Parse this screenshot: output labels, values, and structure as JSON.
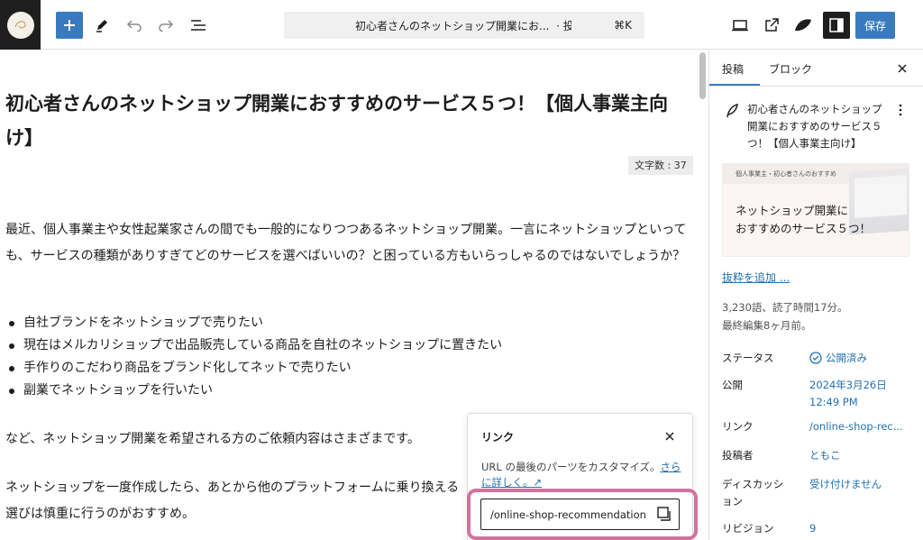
{
  "toolbar": {
    "doc_title": "初心者さんのネットショップ開業にお...",
    "doc_type": "· 投稿",
    "shortcut": "⌘K",
    "save_label": "保存"
  },
  "post": {
    "title": "初心者さんのネットショップ開業におすすめのサービス５つ！【個人事業主向け】",
    "word_count": "文字数 : 37",
    "paragraph1": "最近、個人事業主や女性起業家さんの間でも一般的になりつつあるネットショップ開業。一言にネットショップといっても、サービスの種類がありすぎてどのサービスを選べばいいの？と困っている方もいらっしゃるのではないでしょうか？",
    "bullets": [
      "自社ブランドをネットショップで売りたい",
      "現在はメルカリショップで出品販売している商品を自社のネットショップに置きたい",
      "手作りのこだわり商品をブランド化してネットで売りたい",
      "副業でネットショップを行いたい"
    ],
    "paragraph2": "など、ネットショップ開業を希望される方のご依頼内容はさまざまです。",
    "paragraph3": "ネットショップを一度作成したら、あとから他のプラットフォームに乗り換える",
    "paragraph3b": "選びは慎重に行うのがおすすめ。"
  },
  "link_popover": {
    "title": "リンク",
    "description": "URL の最後のパーツをカスタマイズ。",
    "learn_more": "さらに詳しく。↗",
    "slug": "/online-shop-recommendation"
  },
  "sidebar": {
    "tab_post": "投稿",
    "tab_block": "ブロック",
    "summary_title": "初心者さんのネットショップ開業におすすめのサービス５つ！【個人事業主向け】",
    "featured_band": "個人事業主・初心者さんのおすすめ",
    "featured_text": "ネットショップ開業に\nおすすめのサービス５つ！",
    "excerpt_link": "抜粋を追加 ...",
    "stats_words": "3,230語、読了時間17分。",
    "stats_edited": "最終編集8ヶ月前。",
    "rows": [
      {
        "label": "ステータス",
        "value": "公開済み"
      },
      {
        "label": "公開",
        "value": "2024年3月26日\n12:49 PM"
      },
      {
        "label": "リンク",
        "value": "/online-shop-rec..."
      },
      {
        "label": "投稿者",
        "value": "ともこ"
      },
      {
        "label": "ディスカッション",
        "value": "受け付けません"
      },
      {
        "label": "リビジョン",
        "value": "9"
      }
    ]
  }
}
